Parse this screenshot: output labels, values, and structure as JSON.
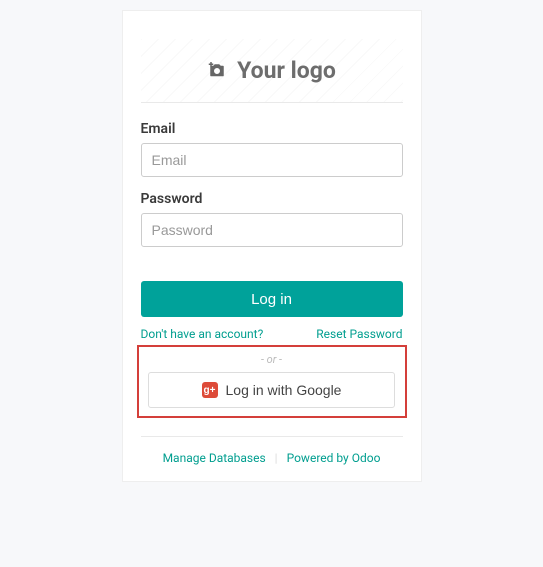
{
  "logo": {
    "placeholder_text": "Your logo"
  },
  "form": {
    "email_label": "Email",
    "email_placeholder": "Email",
    "password_label": "Password",
    "password_placeholder": "Password",
    "login_button": "Log in",
    "no_account_link": "Don't have an account?",
    "reset_link": "Reset Password",
    "or_text": "- or -",
    "google_button": "Log in with Google"
  },
  "footer": {
    "manage_db": "Manage Databases",
    "powered_by": "Powered by Odoo"
  },
  "colors": {
    "accent": "#00a29a",
    "google": "#dd4b39"
  }
}
